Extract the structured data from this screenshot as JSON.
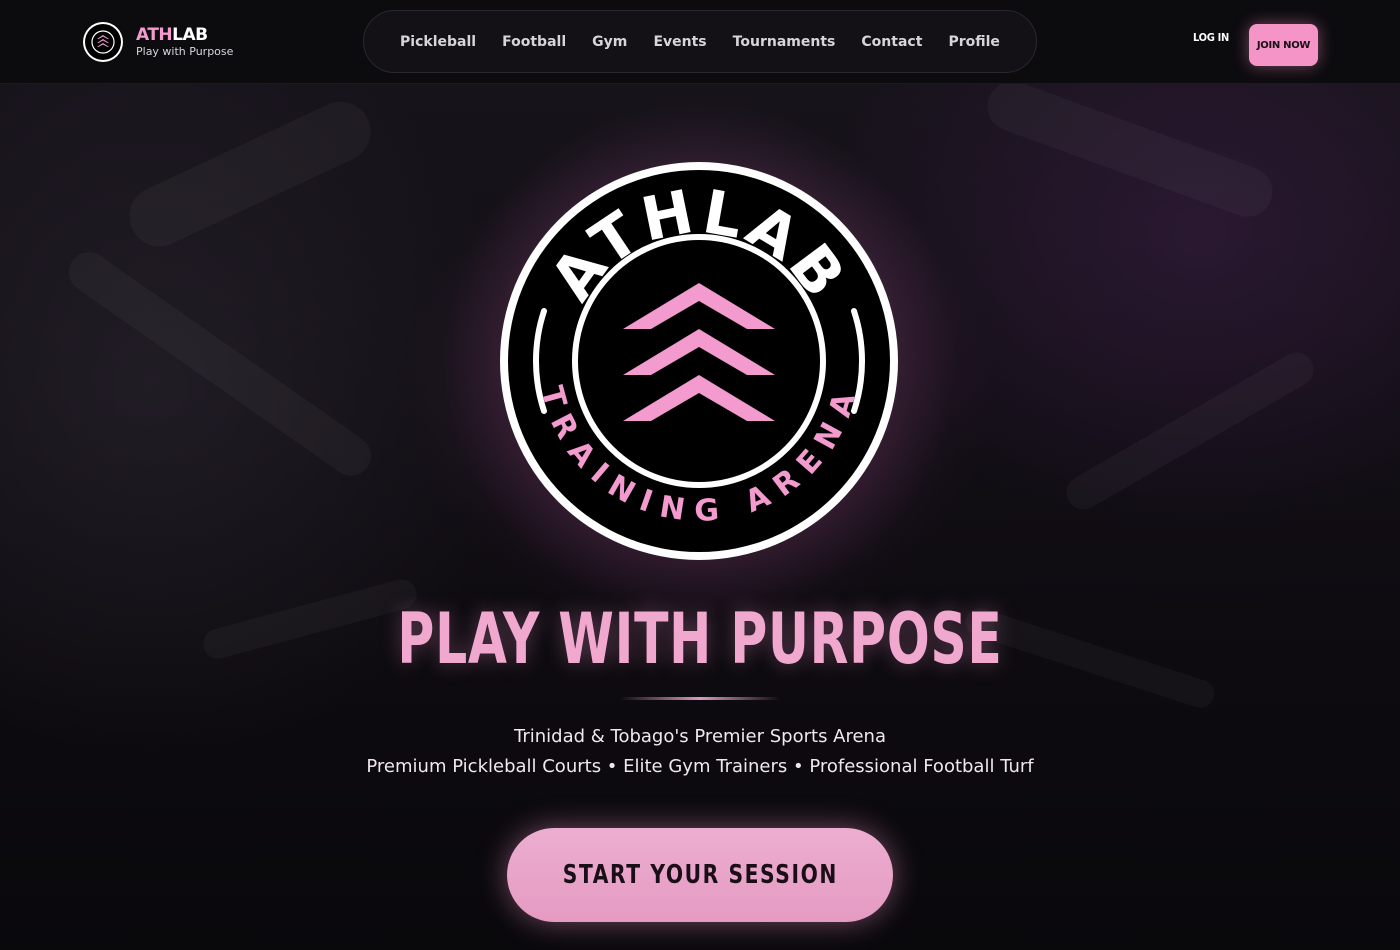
{
  "header": {
    "brand": {
      "name_accent": "ATH",
      "name_rest": "LAB",
      "tagline": "Play with Purpose"
    },
    "nav": [
      {
        "label": "Pickleball"
      },
      {
        "label": "Football"
      },
      {
        "label": "Gym"
      },
      {
        "label": "Events"
      },
      {
        "label": "Tournaments"
      },
      {
        "label": "Contact"
      },
      {
        "label": "Profile"
      }
    ],
    "login_label": "LOG IN",
    "join_label": "JOIN NOW"
  },
  "hero": {
    "emblem": {
      "top_text": "ATHLAB",
      "bottom_text": "TRAINING ARENA",
      "icon": "triple-chevron-up-icon"
    },
    "headline": "PLAY WITH PURPOSE",
    "subtitle_line1": "Trinidad & Tobago's Premier Sports Arena",
    "subtitle_line2": "Premium Pickleball Courts • Elite Gym Trainers • Professional Football Turf",
    "cta_label": "START YOUR SESSION"
  },
  "colors": {
    "accent": "#f594c6",
    "headline": "#f0a8cf",
    "background": "#0b0a0d"
  }
}
